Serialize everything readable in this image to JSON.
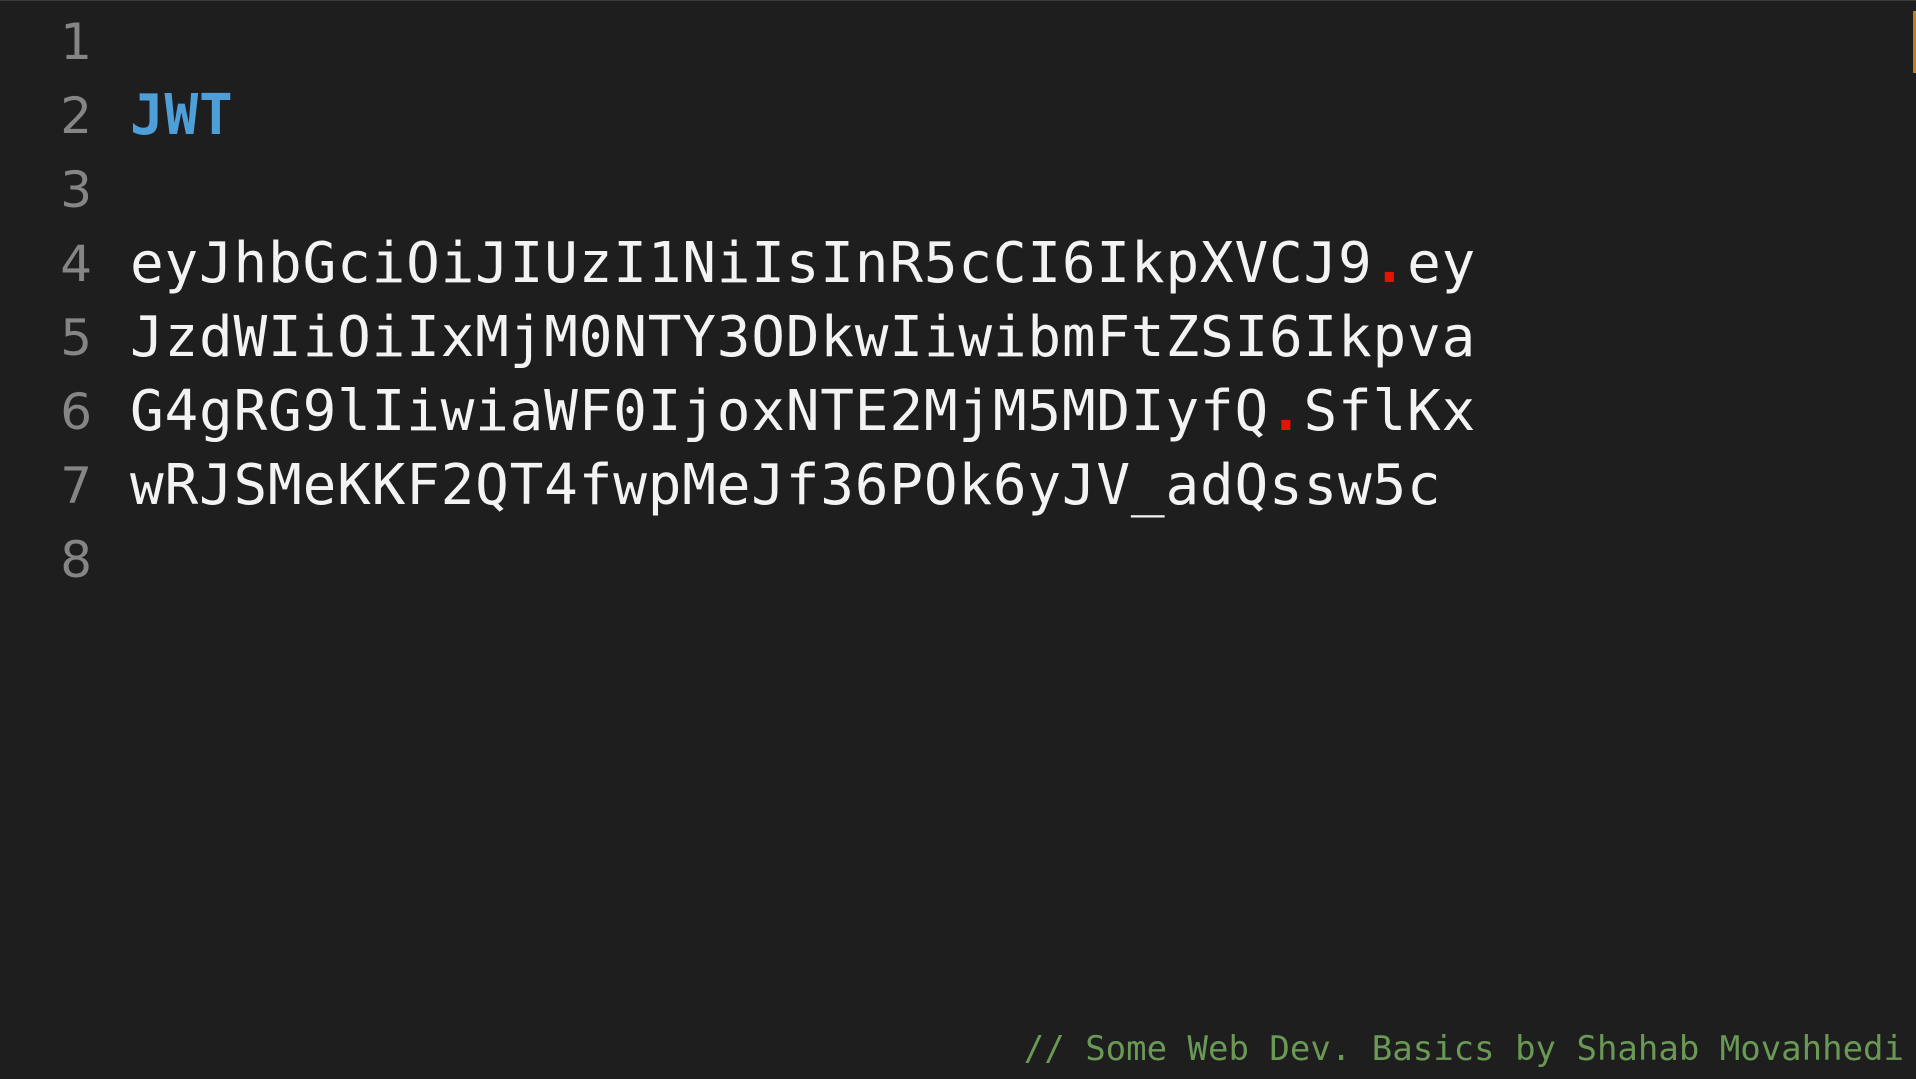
{
  "editor": {
    "line_numbers": [
      "1",
      "2",
      "3",
      "4",
      "5",
      "6",
      "7",
      "8"
    ],
    "heading": "JWT",
    "token": {
      "line4_part1": "eyJhbGciOiJIUzI1NiIsInR5cCI6IkpXVCJ9",
      "line4_dot": ".",
      "line4_part2": "ey",
      "line5": "JzdWIiOiIxMjM0NTY3ODkwIiwibmFtZSI6Ikpva",
      "line6_part1": "G4gRG9lIiwiaWF0IjoxNTE2MjM5MDIyfQ",
      "line6_dot": ".",
      "line6_part2": "SflKx",
      "line7": "wRJSMeKKF2QT4fwpMeJf36POk6yJV_adQssw5c"
    },
    "footer_comment": "// Some Web Dev. Basics by Shahab Movahhedi",
    "colors": {
      "background": "#1e1e1e",
      "line_number": "#858585",
      "heading": "#4e9fd8",
      "text": "#f3f3f3",
      "dot": "#e51400",
      "comment": "#6a9955"
    }
  }
}
